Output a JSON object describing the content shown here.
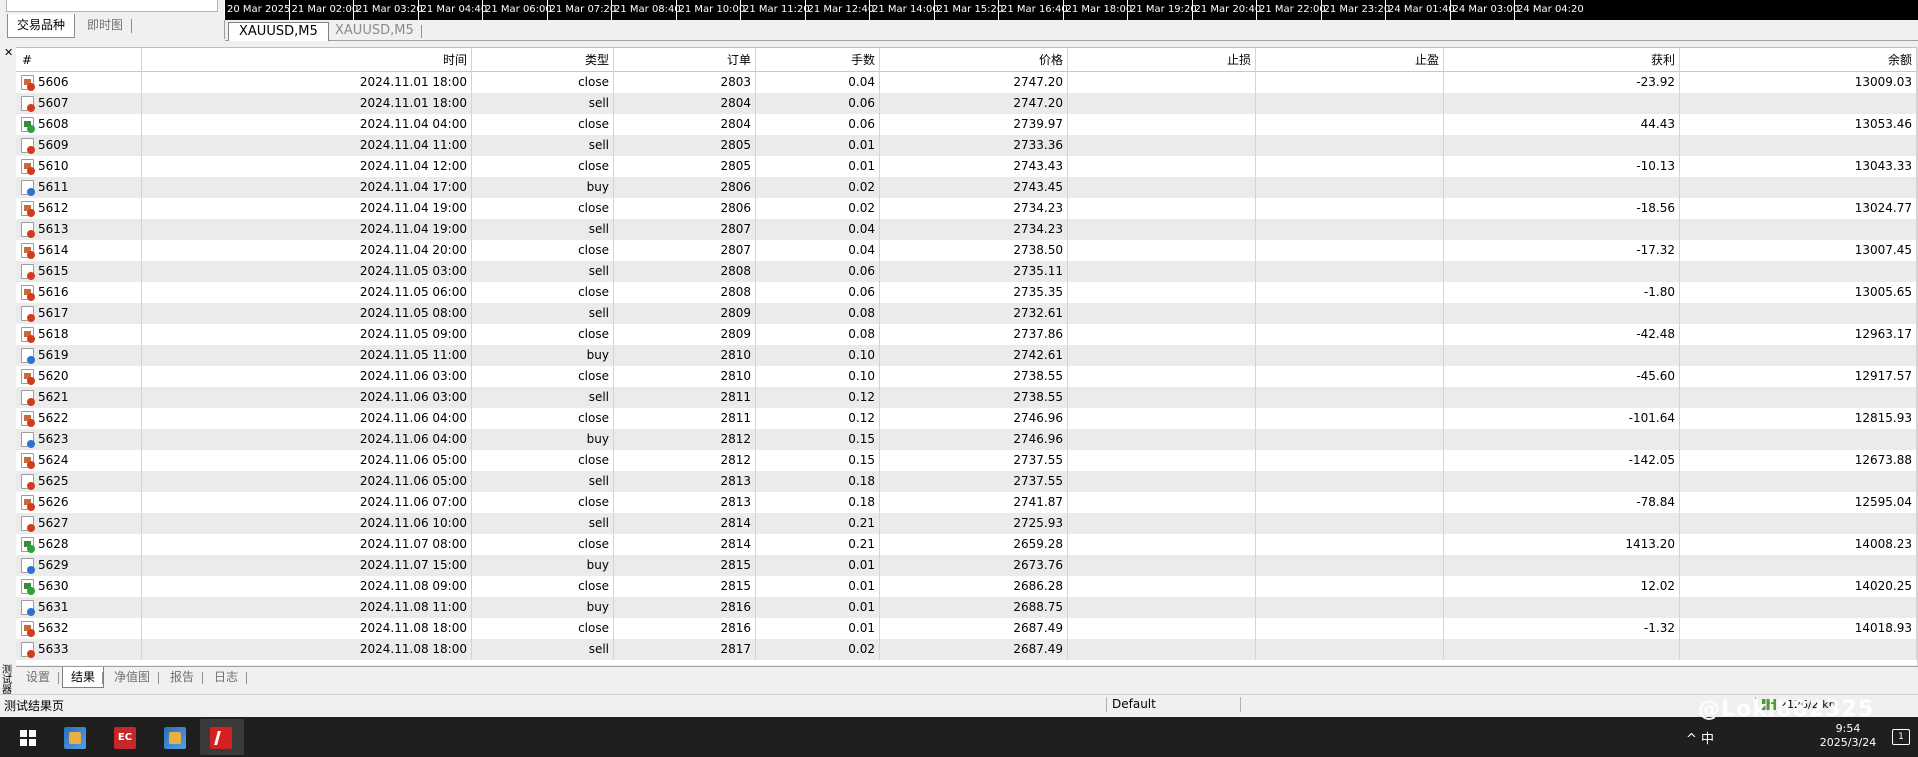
{
  "top_left_tabs": {
    "active": "交易品种",
    "inactive": "即时图"
  },
  "timeaxis_ticks": [
    "20 Mar 2025",
    "21 Mar 02:00",
    "21 Mar 03:20",
    "21 Mar 04:40",
    "21 Mar 06:00",
    "21 Mar 07:20",
    "21 Mar 08:40",
    "21 Mar 10:00",
    "21 Mar 11:20",
    "21 Mar 12:40",
    "21 Mar 14:00",
    "21 Mar 15:20",
    "21 Mar 16:40",
    "21 Mar 18:00",
    "21 Mar 19:20",
    "21 Mar 20:40",
    "21 Mar 22:00",
    "21 Mar 23:20",
    "24 Mar 01:40",
    "24 Mar 03:00",
    "24 Mar 04:20"
  ],
  "chart_tabs": [
    "XAUUSD,M5",
    "XAUUSD,M5"
  ],
  "columns": [
    "#",
    "时间",
    "类型",
    "订单",
    "手数",
    "价格",
    "止损",
    "止盈",
    "获利",
    "余额"
  ],
  "rows": [
    {
      "id": "5606",
      "time": "2024.11.01 18:00",
      "type": "close",
      "order": "2803",
      "lots": "0.04",
      "price": "2747.20",
      "sl": "",
      "tp": "",
      "profit": "-23.92",
      "balance": "13009.03",
      "icon": "close"
    },
    {
      "id": "5607",
      "time": "2024.11.01 18:00",
      "type": "sell",
      "order": "2804",
      "lots": "0.06",
      "price": "2747.20",
      "sl": "",
      "tp": "",
      "profit": "",
      "balance": "",
      "icon": "sell"
    },
    {
      "id": "5608",
      "time": "2024.11.04 04:00",
      "type": "close",
      "order": "2804",
      "lots": "0.06",
      "price": "2739.97",
      "sl": "",
      "tp": "",
      "profit": "44.43",
      "balance": "13053.46",
      "icon": "close-win"
    },
    {
      "id": "5609",
      "time": "2024.11.04 11:00",
      "type": "sell",
      "order": "2805",
      "lots": "0.01",
      "price": "2733.36",
      "sl": "",
      "tp": "",
      "profit": "",
      "balance": "",
      "icon": "sell"
    },
    {
      "id": "5610",
      "time": "2024.11.04 12:00",
      "type": "close",
      "order": "2805",
      "lots": "0.01",
      "price": "2743.43",
      "sl": "",
      "tp": "",
      "profit": "-10.13",
      "balance": "13043.33",
      "icon": "close"
    },
    {
      "id": "5611",
      "time": "2024.11.04 17:00",
      "type": "buy",
      "order": "2806",
      "lots": "0.02",
      "price": "2743.45",
      "sl": "",
      "tp": "",
      "profit": "",
      "balance": "",
      "icon": "buy"
    },
    {
      "id": "5612",
      "time": "2024.11.04 19:00",
      "type": "close",
      "order": "2806",
      "lots": "0.02",
      "price": "2734.23",
      "sl": "",
      "tp": "",
      "profit": "-18.56",
      "balance": "13024.77",
      "icon": "close"
    },
    {
      "id": "5613",
      "time": "2024.11.04 19:00",
      "type": "sell",
      "order": "2807",
      "lots": "0.04",
      "price": "2734.23",
      "sl": "",
      "tp": "",
      "profit": "",
      "balance": "",
      "icon": "sell"
    },
    {
      "id": "5614",
      "time": "2024.11.04 20:00",
      "type": "close",
      "order": "2807",
      "lots": "0.04",
      "price": "2738.50",
      "sl": "",
      "tp": "",
      "profit": "-17.32",
      "balance": "13007.45",
      "icon": "close"
    },
    {
      "id": "5615",
      "time": "2024.11.05 03:00",
      "type": "sell",
      "order": "2808",
      "lots": "0.06",
      "price": "2735.11",
      "sl": "",
      "tp": "",
      "profit": "",
      "balance": "",
      "icon": "sell"
    },
    {
      "id": "5616",
      "time": "2024.11.05 06:00",
      "type": "close",
      "order": "2808",
      "lots": "0.06",
      "price": "2735.35",
      "sl": "",
      "tp": "",
      "profit": "-1.80",
      "balance": "13005.65",
      "icon": "close"
    },
    {
      "id": "5617",
      "time": "2024.11.05 08:00",
      "type": "sell",
      "order": "2809",
      "lots": "0.08",
      "price": "2732.61",
      "sl": "",
      "tp": "",
      "profit": "",
      "balance": "",
      "icon": "sell"
    },
    {
      "id": "5618",
      "time": "2024.11.05 09:00",
      "type": "close",
      "order": "2809",
      "lots": "0.08",
      "price": "2737.86",
      "sl": "",
      "tp": "",
      "profit": "-42.48",
      "balance": "12963.17",
      "icon": "close"
    },
    {
      "id": "5619",
      "time": "2024.11.05 11:00",
      "type": "buy",
      "order": "2810",
      "lots": "0.10",
      "price": "2742.61",
      "sl": "",
      "tp": "",
      "profit": "",
      "balance": "",
      "icon": "buy"
    },
    {
      "id": "5620",
      "time": "2024.11.06 03:00",
      "type": "close",
      "order": "2810",
      "lots": "0.10",
      "price": "2738.55",
      "sl": "",
      "tp": "",
      "profit": "-45.60",
      "balance": "12917.57",
      "icon": "close"
    },
    {
      "id": "5621",
      "time": "2024.11.06 03:00",
      "type": "sell",
      "order": "2811",
      "lots": "0.12",
      "price": "2738.55",
      "sl": "",
      "tp": "",
      "profit": "",
      "balance": "",
      "icon": "sell"
    },
    {
      "id": "5622",
      "time": "2024.11.06 04:00",
      "type": "close",
      "order": "2811",
      "lots": "0.12",
      "price": "2746.96",
      "sl": "",
      "tp": "",
      "profit": "-101.64",
      "balance": "12815.93",
      "icon": "close"
    },
    {
      "id": "5623",
      "time": "2024.11.06 04:00",
      "type": "buy",
      "order": "2812",
      "lots": "0.15",
      "price": "2746.96",
      "sl": "",
      "tp": "",
      "profit": "",
      "balance": "",
      "icon": "buy"
    },
    {
      "id": "5624",
      "time": "2024.11.06 05:00",
      "type": "close",
      "order": "2812",
      "lots": "0.15",
      "price": "2737.55",
      "sl": "",
      "tp": "",
      "profit": "-142.05",
      "balance": "12673.88",
      "icon": "close"
    },
    {
      "id": "5625",
      "time": "2024.11.06 05:00",
      "type": "sell",
      "order": "2813",
      "lots": "0.18",
      "price": "2737.55",
      "sl": "",
      "tp": "",
      "profit": "",
      "balance": "",
      "icon": "sell"
    },
    {
      "id": "5626",
      "time": "2024.11.06 07:00",
      "type": "close",
      "order": "2813",
      "lots": "0.18",
      "price": "2741.87",
      "sl": "",
      "tp": "",
      "profit": "-78.84",
      "balance": "12595.04",
      "icon": "close"
    },
    {
      "id": "5627",
      "time": "2024.11.06 10:00",
      "type": "sell",
      "order": "2814",
      "lots": "0.21",
      "price": "2725.93",
      "sl": "",
      "tp": "",
      "profit": "",
      "balance": "",
      "icon": "sell"
    },
    {
      "id": "5628",
      "time": "2024.11.07 08:00",
      "type": "close",
      "order": "2814",
      "lots": "0.21",
      "price": "2659.28",
      "sl": "",
      "tp": "",
      "profit": "1413.20",
      "balance": "14008.23",
      "icon": "close-win"
    },
    {
      "id": "5629",
      "time": "2024.11.07 15:00",
      "type": "buy",
      "order": "2815",
      "lots": "0.01",
      "price": "2673.76",
      "sl": "",
      "tp": "",
      "profit": "",
      "balance": "",
      "icon": "buy"
    },
    {
      "id": "5630",
      "time": "2024.11.08 09:00",
      "type": "close",
      "order": "2815",
      "lots": "0.01",
      "price": "2686.28",
      "sl": "",
      "tp": "",
      "profit": "12.02",
      "balance": "14020.25",
      "icon": "close-win"
    },
    {
      "id": "5631",
      "time": "2024.11.08 11:00",
      "type": "buy",
      "order": "2816",
      "lots": "0.01",
      "price": "2688.75",
      "sl": "",
      "tp": "",
      "profit": "",
      "balance": "",
      "icon": "buy"
    },
    {
      "id": "5632",
      "time": "2024.11.08 18:00",
      "type": "close",
      "order": "2816",
      "lots": "0.01",
      "price": "2687.49",
      "sl": "",
      "tp": "",
      "profit": "-1.32",
      "balance": "14018.93",
      "icon": "close"
    },
    {
      "id": "5633",
      "time": "2024.11.08 18:00",
      "type": "sell",
      "order": "2817",
      "lots": "0.02",
      "price": "2687.49",
      "sl": "",
      "tp": "",
      "profit": "",
      "balance": "",
      "icon": "sell"
    }
  ],
  "vertical_label": "测试器",
  "bottom_tabs": [
    {
      "label": "设置",
      "active": false
    },
    {
      "label": "结果",
      "active": true
    },
    {
      "label": "净值图",
      "active": false
    },
    {
      "label": "报告",
      "active": false
    },
    {
      "label": "日志",
      "active": false
    }
  ],
  "status": {
    "left": "测试结果页",
    "profile": "Default",
    "connection": "2126/2 kb"
  },
  "taskbar": {
    "tray_text": "^ 中",
    "time": "9:54",
    "date": "2025/3/24",
    "watermark": "@Loki882325",
    "notification": "1"
  },
  "colors": {
    "row_alt": "#ebebeb",
    "grid_line": "#d4d4d4",
    "timeaxis_bg": "#000000",
    "taskbar_bg": "#1f1f1f"
  }
}
